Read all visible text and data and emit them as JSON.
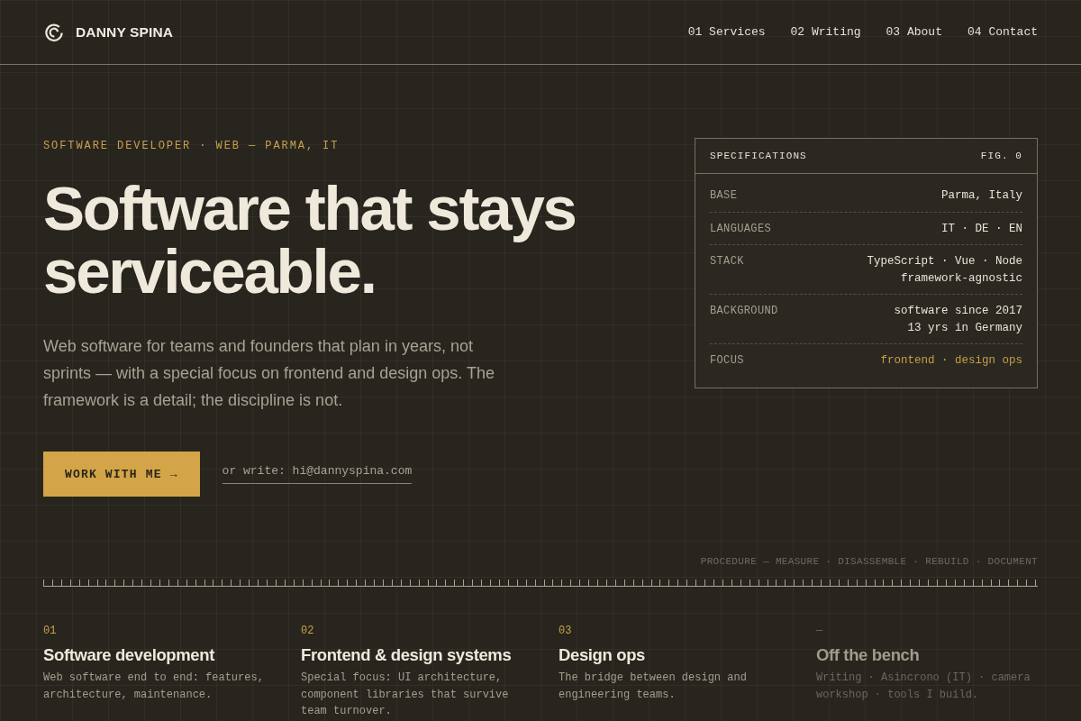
{
  "header": {
    "brand": "DANNY SPINA",
    "nav": [
      "01 Services",
      "02 Writing",
      "03 About",
      "04 Contact"
    ]
  },
  "hero": {
    "eyebrow": "SOFTWARE DEVELOPER · WEB — PARMA, IT",
    "headline": "Software that stays serviceable.",
    "intro": "Web software for teams and founders that plan in years, not sprints — with a special focus on frontend and design ops. The framework is a detail; the discipline is not.",
    "cta": "WORK WITH ME →",
    "email_link": "or write: hi@dannyspina.com"
  },
  "specs": {
    "title": "SPECIFICATIONS",
    "figure": "FIG. 0",
    "rows": [
      {
        "label": "BASE",
        "values": [
          "Parma, Italy"
        ],
        "highlight": false
      },
      {
        "label": "LANGUAGES",
        "values": [
          "IT · DE · EN"
        ],
        "highlight": false
      },
      {
        "label": "STACK",
        "values": [
          "TypeScript · Vue · Node",
          "framework-agnostic"
        ],
        "highlight": false
      },
      {
        "label": "BACKGROUND",
        "values": [
          "software since 2017",
          "13 yrs in Germany"
        ],
        "highlight": false
      },
      {
        "label": "FOCUS",
        "values": [
          "frontend · design ops"
        ],
        "highlight": true
      }
    ]
  },
  "procedure": "PROCEDURE — MEASURE · DISASSEMBLE · REBUILD · DOCUMENT",
  "services": [
    {
      "number": "01",
      "title": "Software development",
      "description": "Web software end to end: features, architecture, maintenance.",
      "dimmed": false
    },
    {
      "number": "02",
      "title": "Frontend & design systems",
      "description": "Special focus: UI architecture, component libraries that survive team turnover.",
      "dimmed": false
    },
    {
      "number": "03",
      "title": "Design ops",
      "description": "The bridge between design and engineering teams.",
      "dimmed": false
    },
    {
      "number": "—",
      "title": "Off the bench",
      "description": "Writing · Asincrono (IT) · camera workshop · tools I build.",
      "dimmed": true
    }
  ]
}
